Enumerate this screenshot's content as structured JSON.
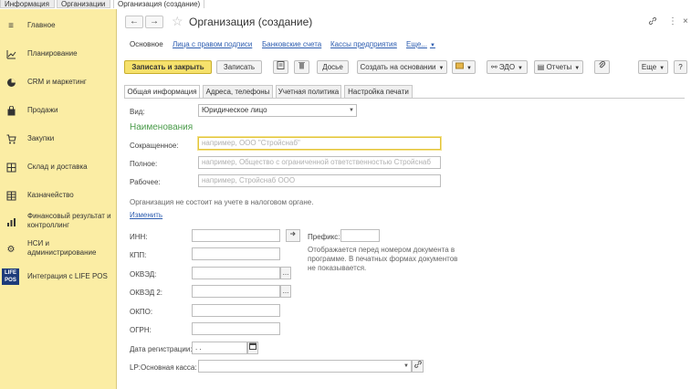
{
  "top_tabs": [
    "Информация",
    "Организации",
    "Организация (создание)"
  ],
  "sidebar": {
    "items": [
      {
        "label": "Главное",
        "icon": "menu-icon"
      },
      {
        "label": "Планирование",
        "icon": "chart-icon"
      },
      {
        "label": "CRM и маркетинг",
        "icon": "pie-icon"
      },
      {
        "label": "Продажи",
        "icon": "bag-icon"
      },
      {
        "label": "Закупки",
        "icon": "cart-icon"
      },
      {
        "label": "Склад и доставка",
        "icon": "grid-icon"
      },
      {
        "label": "Казначейство",
        "icon": "grid-icon"
      },
      {
        "label": "Финансовый результат и контроллинг",
        "icon": "bars-icon"
      },
      {
        "label": "НСИ и администрирование",
        "icon": "gear-icon"
      },
      {
        "label": "Интеграция с LIFE POS",
        "icon": "lifepos-logo"
      }
    ],
    "logo_text": "LIFE POS"
  },
  "header": {
    "back": "←",
    "forward": "→",
    "star": "☆",
    "title": "Организация (создание)",
    "link_icon": "🔗",
    "more_icon": "⋮",
    "close_icon": "×"
  },
  "subnav": {
    "main": "Основное",
    "links": [
      "Лица с правом подписи",
      "Банковские счета",
      "Кассы предприятия"
    ],
    "more": "Еще..."
  },
  "toolbar": {
    "save_close": "Записать и закрыть",
    "save": "Записать",
    "dossier": "Досье",
    "create_based": "Создать на основании",
    "edo": "ЭДО",
    "reports": "Отчеты",
    "more": "Еще",
    "help": "?"
  },
  "tabs": [
    "Общая информация",
    "Адреса, телефоны",
    "Учетная политика",
    "Настройка печати"
  ],
  "form": {
    "vid_label": "Вид:",
    "vid_value": "Юридическое лицо",
    "section_title": "Наименования",
    "short_label": "Сокращенное:",
    "short_placeholder": "например, ООО \"Стройснаб\"",
    "full_label": "Полное:",
    "full_placeholder": "например, Общество с ограниченной ответственностью Стройснаб",
    "work_label": "Рабочее:",
    "work_placeholder": "например, Стройснаб ООО",
    "tax_info": "Организация не состоит на учете в налоговом органе.",
    "change_link": "Изменить",
    "inn_label": "ИНН:",
    "prefix_label": "Префикс:",
    "prefix_info": "Отображается перед номером документа в программе. В печатных формах документов не показывается.",
    "kpp_label": "КПП:",
    "okved_label": "ОКВЭД:",
    "okved2_label": "ОКВЭД 2:",
    "okpo_label": "ОКПО:",
    "ogrn_label": "ОГРН:",
    "reg_date_label": "Дата регистрации:",
    "reg_date_value": " .  .",
    "cash_label": "LP:Основная касса:",
    "ellipsis": "..."
  }
}
